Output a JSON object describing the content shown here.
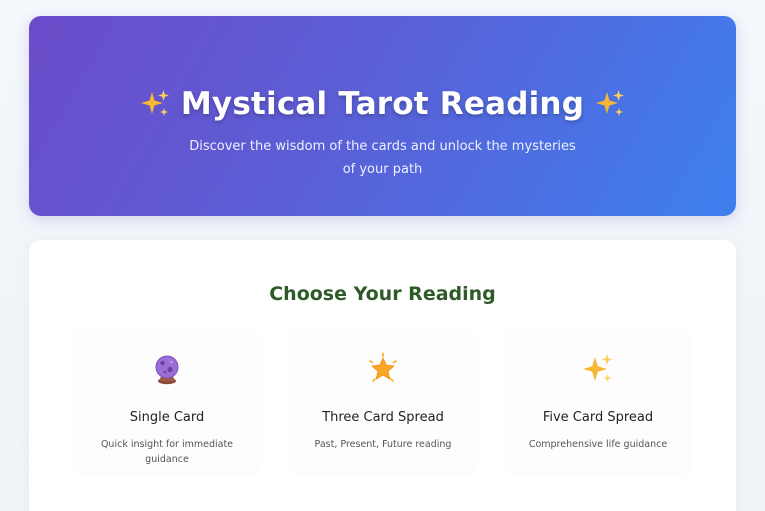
{
  "hero": {
    "title": "Mystical Tarot Reading",
    "title_icon": "sparkles-icon",
    "subtitle": "Discover the wisdom of the cards and unlock the mysteries of your path"
  },
  "selection": {
    "heading": "Choose Your Reading",
    "options": [
      {
        "icon": "crystal-ball-icon",
        "name": "Single Card",
        "description": "Quick insight for immediate guidance"
      },
      {
        "icon": "glowing-star-icon",
        "name": "Three Card Spread",
        "description": "Past, Present, Future reading"
      },
      {
        "icon": "sparkles-icon",
        "name": "Five Card Spread",
        "description": "Comprehensive life guidance"
      }
    ]
  },
  "colors": {
    "hero_gradient_start": "#6b4cc9",
    "hero_gradient_end": "#3d80ef",
    "heading_green": "#2d5a27",
    "sparkle_gold": "#f5b83d"
  }
}
